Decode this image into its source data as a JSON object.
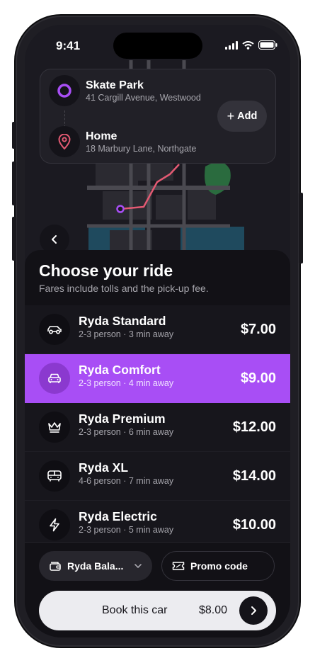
{
  "status": {
    "time": "9:41"
  },
  "route": {
    "pickup": {
      "name": "Skate Park",
      "address": "41 Cargill Avenue, Westwood"
    },
    "dropoff": {
      "name": "Home",
      "address": "18 Marbury Lane, Northgate"
    },
    "add_label": "Add"
  },
  "sheet": {
    "title": "Choose your ride",
    "subtitle": "Fares include tolls and the pick-up fee."
  },
  "rides": [
    {
      "name": "Ryda Standard",
      "meta": "2-3 person · 3 min away",
      "price": "$7.00",
      "icon": "car-icon"
    },
    {
      "name": "Ryda Comfort",
      "meta": "2-3 person · 4 min away",
      "price": "$9.00",
      "icon": "car-front-icon"
    },
    {
      "name": "Ryda Premium",
      "meta": "2-3 person · 6 min away",
      "price": "$12.00",
      "icon": "crown-icon"
    },
    {
      "name": "Ryda XL",
      "meta": "4-6 person · 7 min away",
      "price": "$14.00",
      "icon": "bus-icon"
    },
    {
      "name": "Ryda Electric",
      "meta": "2-3 person · 5 min away",
      "price": "$10.00",
      "icon": "lightning-icon"
    }
  ],
  "selected_ride": 1,
  "payment": {
    "method": "Ryda Bala...",
    "promo": "Promo code"
  },
  "book": {
    "label": "Book this car",
    "price": "$8.00"
  },
  "colors": {
    "accent": "#a84ef5",
    "pin": "#e45a73",
    "park": "#2a6b3e"
  }
}
